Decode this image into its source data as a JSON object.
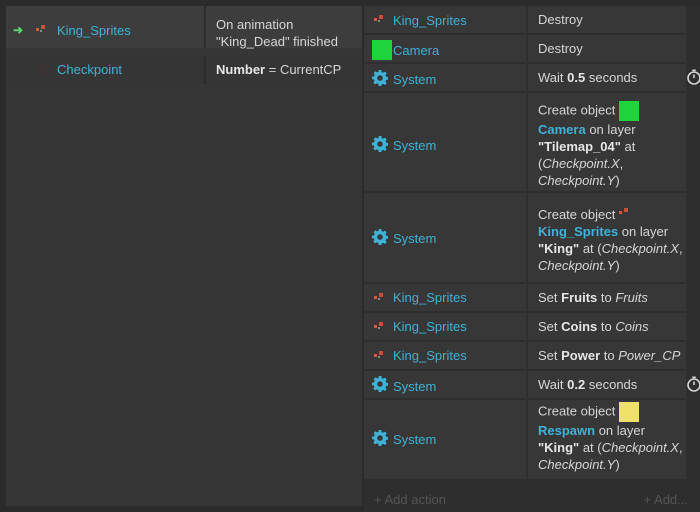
{
  "conditions": [
    {
      "object": "King_Sprites",
      "text_prefix": "On animation",
      "text_suffix": "\"King_Dead\" finished"
    },
    {
      "object": "Checkpoint",
      "bold": "Number",
      "text": " = CurrentCP"
    }
  ],
  "actions": [
    {
      "object": "King_Sprites",
      "icon": "sprite-icon",
      "text": "Destroy"
    },
    {
      "object": "Camera",
      "icon": "green-square-icon",
      "text": "Destroy"
    },
    {
      "object": "System",
      "icon": "gear-icon",
      "pre": "Wait ",
      "bold": "0.5",
      "post": " seconds",
      "timer": true
    },
    {
      "object": "System",
      "icon": "gear-icon",
      "l1": "Create object ",
      "obj": "Camera",
      "mid": " on layer",
      "layer": "\"Tilemap_04\"",
      "at": " at",
      "coords": "(Checkpoint.X, Checkpoint.Y)",
      "coords_a": "Checkpoint.X",
      "coords_b": "Checkpoint.Y"
    },
    {
      "object": "System",
      "icon": "gear-icon",
      "l1": "Create object ",
      "obj": "King_Sprites",
      "mid": " on layer",
      "layer": "\"King\"",
      "at": " at",
      "coords_a": "Checkpoint.X",
      "coords_b": "Checkpoint.Y"
    },
    {
      "object": "King_Sprites",
      "icon": "sprite-icon",
      "pre": "Set ",
      "bold": "Fruits",
      "post": " to ",
      "ital": "Fruits"
    },
    {
      "object": "King_Sprites",
      "icon": "sprite-icon",
      "pre": "Set ",
      "bold": "Coins",
      "post": " to ",
      "ital": "Coins"
    },
    {
      "object": "King_Sprites",
      "icon": "sprite-icon",
      "pre": "Set ",
      "bold": "Power",
      "post": " to ",
      "ital": "Power_CP"
    },
    {
      "object": "System",
      "icon": "gear-icon",
      "pre": "Wait ",
      "bold": "0.2",
      "post": " seconds",
      "timer": true
    },
    {
      "object": "System",
      "icon": "gear-icon",
      "l1": "Create object ",
      "obj": "Respawn",
      "mid": " on layer",
      "layer": "\"King\"",
      "at": " at",
      "coords_a": "Checkpoint.X",
      "coords_b": "Checkpoint.Y"
    }
  ],
  "footer": {
    "add_action": "+ Add action",
    "add_more": "+ Add..."
  },
  "colors": {
    "link": "#3fb2d7",
    "green": "#1ed43c",
    "yellow": "#efe068",
    "arrow": "#55d46a"
  }
}
